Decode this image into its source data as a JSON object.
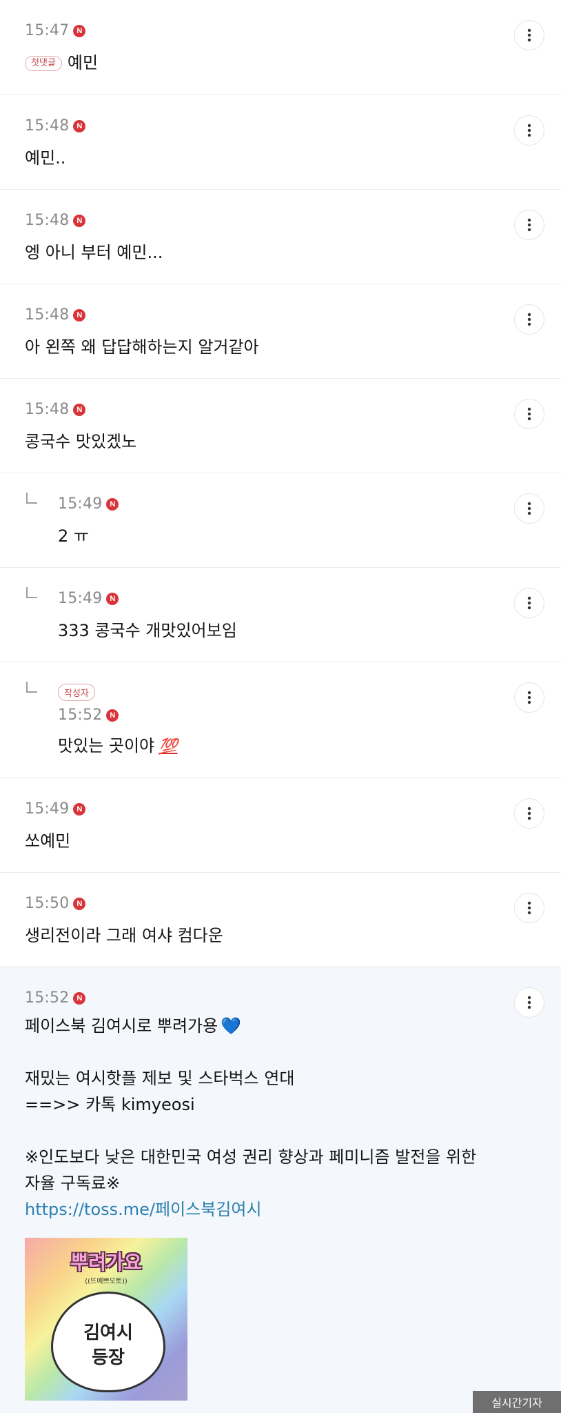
{
  "comments": [
    {
      "time": "15:47",
      "badge": "N",
      "tag": "첫댓글",
      "text": "예민"
    },
    {
      "time": "15:48",
      "badge": "N",
      "text": "예민.."
    },
    {
      "time": "15:48",
      "badge": "N",
      "text": "엥 아니 부터 예민..."
    },
    {
      "time": "15:48",
      "badge": "N",
      "text": "아 왼쪽 왜 답답해하는지 알거같아"
    },
    {
      "time": "15:48",
      "badge": "N",
      "text": "콩국수 맛있겠노"
    },
    {
      "time": "15:49",
      "badge": "N",
      "text": "2 ㅠ"
    },
    {
      "time": "15:49",
      "badge": "N",
      "text": "333 콩국수 개맛있어보임"
    },
    {
      "time": "15:52",
      "badge": "N",
      "tag": "작성자",
      "text": "맛있는 곳이야",
      "emoji": "💯"
    },
    {
      "time": "15:49",
      "badge": "N",
      "text": "쏘예민"
    },
    {
      "time": "15:50",
      "badge": "N",
      "text": "생리전이라 그래 여샤 컴다운"
    },
    {
      "time": "15:52",
      "badge": "N",
      "line1": "페이스북 김여시로 뿌려가용",
      "heart": "💙",
      "line2": "재밌는 여시핫플 제보 및 스타벅스 연대",
      "line3": "==>> 카톡 kimyeosi",
      "line4": "※인도보다 낮은 대한민국 여성 권리 향상과 페미니즘 발전을 위한",
      "line5": "자율 구독료※",
      "link": "https://toss.me/페이스북김여시",
      "sticker_title": "뿌려가요",
      "sticker_sub": "((뜨예쁘오토))",
      "sticker_line1": "김여시",
      "sticker_line2": "등장"
    }
  ],
  "more_icon": "more-vertical-icon",
  "watermark": "실시간기자",
  "colors": {
    "badge": "#d9343a",
    "link": "#2a7fb0",
    "highlight_bg": "#f4f7fb"
  }
}
